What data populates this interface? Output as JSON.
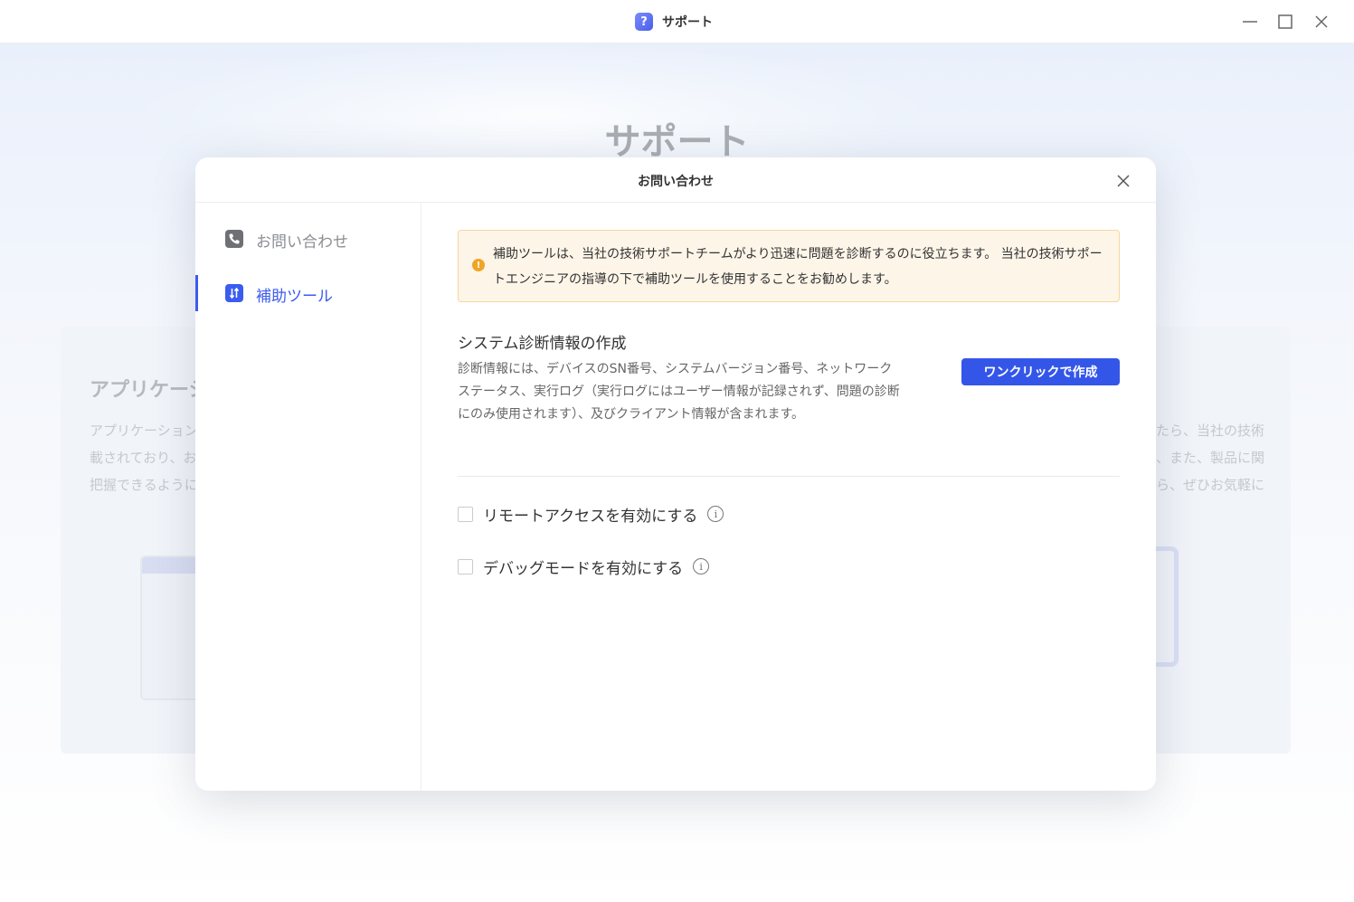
{
  "window": {
    "title": "サポート",
    "app_icon_glyph": "?"
  },
  "background": {
    "heading": "サポート",
    "card_title": "アプリケーシ",
    "card_lines_left": [
      "アプリケーション",
      "載されており、お",
      "把握できるように"
    ],
    "card_lines_right": [
      "たら、当社の技術",
      "、また、製品に関",
      "ら、ぜひお気軽に"
    ]
  },
  "dialog": {
    "title": "お問い合わせ",
    "sidebar": {
      "items": [
        {
          "label": "お問い合わせ",
          "icon": "phone-icon"
        },
        {
          "label": "補助ツール",
          "icon": "tools-icon"
        }
      ]
    },
    "notice": {
      "icon": "warning-info-icon",
      "text": "補助ツールは、当社の技術サポートチームがより迅速に問題を診断するのに役立ちます。 当社の技術サポートエンジニアの指導の下で補助ツールを使用することをお勧めします。"
    },
    "diagnostics": {
      "title": "システム診断情報の作成",
      "description": "診断情報には、デバイスのSN番号、システムバージョン番号、ネットワークステータス、実行ログ（実行ログにはユーザー情報が記録されず、問題の診断にのみ使用されます）、及びクライアント情報が含まれます。",
      "button_label": "ワンクリックで作成"
    },
    "options": [
      {
        "label": "リモートアクセスを有効にする",
        "checked": false
      },
      {
        "label": "デバッグモードを有効にする",
        "checked": false
      }
    ],
    "info_glyph": "i"
  },
  "colors": {
    "accent": "#3b5cf0",
    "notice_bg": "#fdf5e8",
    "notice_border": "#f5d79e",
    "notice_icon": "#f0a526"
  }
}
